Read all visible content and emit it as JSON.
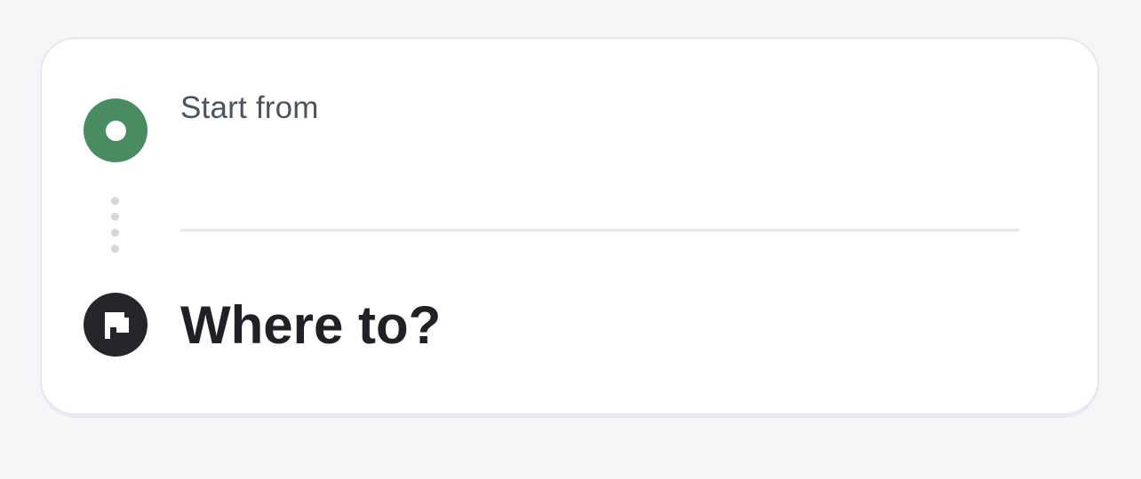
{
  "route": {
    "origin": {
      "label": "Start from",
      "icon": "origin-marker-icon",
      "icon_color": "#4a8c61"
    },
    "destination": {
      "label": "Where to?",
      "icon": "flag-icon",
      "icon_color": "#25262a"
    },
    "connector_icon": "dotted-route-line"
  }
}
